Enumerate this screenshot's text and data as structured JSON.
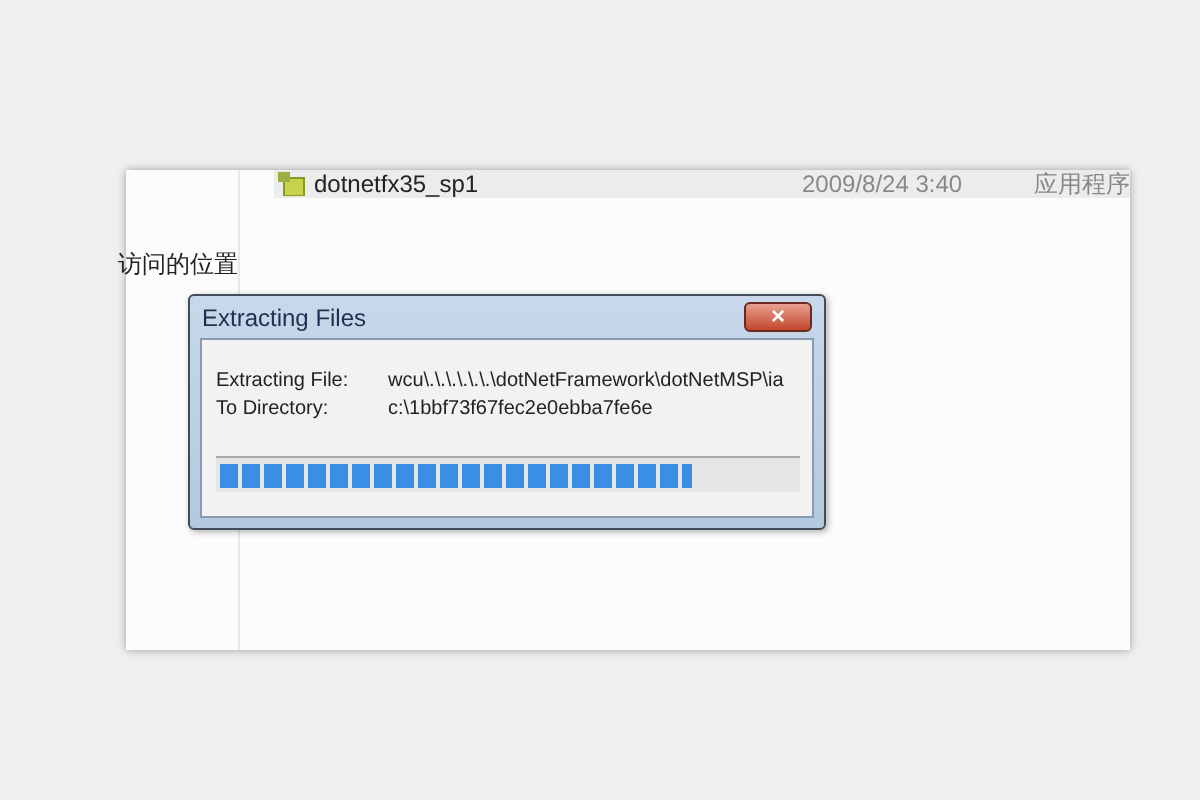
{
  "explorer": {
    "nav_item": "访问的位置",
    "file": {
      "name": "dotnetfx35_sp1",
      "modified": "2009/8/24 3:40",
      "type": "应用程序"
    }
  },
  "dialog": {
    "title": "Extracting Files",
    "close": "×",
    "fields": [
      {
        "label": "Extracting File:",
        "value": "wcu\\.\\.\\.\\.\\.\\.\\dotNetFramework\\dotNetMSP\\ia"
      },
      {
        "label": "To Directory:",
        "value": "c:\\1bbf73f67fec2e0ebba7fe6e"
      }
    ],
    "progress": {
      "level": 0.82
    }
  }
}
